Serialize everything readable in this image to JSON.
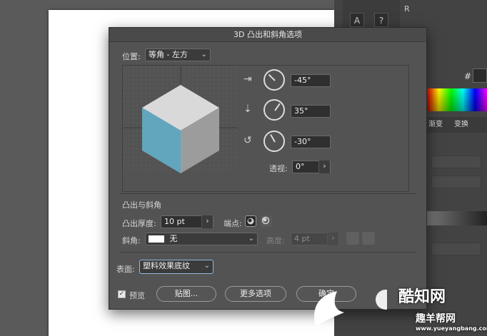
{
  "dialog": {
    "title": "3D 凸出和斜角选项",
    "position_label": "位置:",
    "position_value": "等角 - 左方",
    "rot_x": "-45°",
    "rot_y": "35°",
    "rot_z": "-30°",
    "perspective_label": "透视:",
    "perspective_value": "0°",
    "extrude_section": "凸出与斜角",
    "extrude_depth_label": "凸出厚度:",
    "extrude_depth_value": "10 pt",
    "cap_label": "端点:",
    "bevel_label": "斜角:",
    "bevel_value": "无",
    "height_label": "高度:",
    "height_value": "4 pt",
    "surface_label": "表面:",
    "surface_value": "塑料效果底纹",
    "preview_label": "预览",
    "preview_checked": true,
    "buttons": {
      "map": "贴图...",
      "more": "更多选项",
      "ok": "确定"
    }
  },
  "background_panel": {
    "tool_label_r": "R",
    "hash": "#",
    "tabs": [
      "渐变",
      "变换"
    ]
  },
  "watermark": {
    "brand": "酷知网",
    "brand2": "趣羊帮网",
    "url": "www.yueyangbang.com"
  },
  "colors": {
    "cube_left": "#62a6bd",
    "cube_top": "#d9d9d9",
    "cube_right": "#9c9c9c",
    "dialog_bg": "#535353"
  },
  "icons": [
    "x-axis-rotate-icon",
    "y-axis-rotate-icon",
    "z-axis-rotate-icon",
    "chevron-down-icon",
    "chevron-right-icon",
    "cap-on-icon",
    "cap-off-icon"
  ]
}
